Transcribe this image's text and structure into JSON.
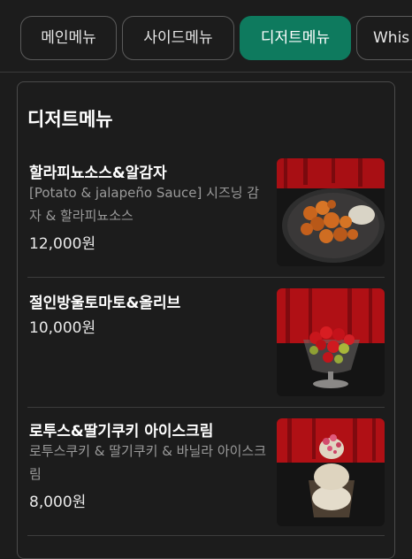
{
  "tabs": [
    {
      "label": "메인메뉴",
      "active": false
    },
    {
      "label": "사이드메뉴",
      "active": false
    },
    {
      "label": "디저트메뉴",
      "active": true
    },
    {
      "label": "Whis",
      "active": false
    }
  ],
  "section": {
    "title": "디저트메뉴"
  },
  "items": [
    {
      "name": "할라피뇨소스&알감자",
      "description": "[Potato & jalapeño Sauce] 시즈닝 감자 & 할라피뇨소스",
      "price": "12,000원",
      "image": "fried-potato-plate"
    },
    {
      "name": "절인방울토마토&올리브",
      "description": "",
      "price": "10,000원",
      "image": "tomato-olive-glass"
    },
    {
      "name": "로투스&딸기쿠키 아이스크림",
      "description": "로투스쿠키 & 딸기쿠키 & 바닐라 아이스크림",
      "price": "8,000원",
      "image": "ice-cream-cup"
    }
  ],
  "colors": {
    "accent": "#0e7a5e",
    "background": "#1c1c1c",
    "curtain": "#b01015"
  }
}
